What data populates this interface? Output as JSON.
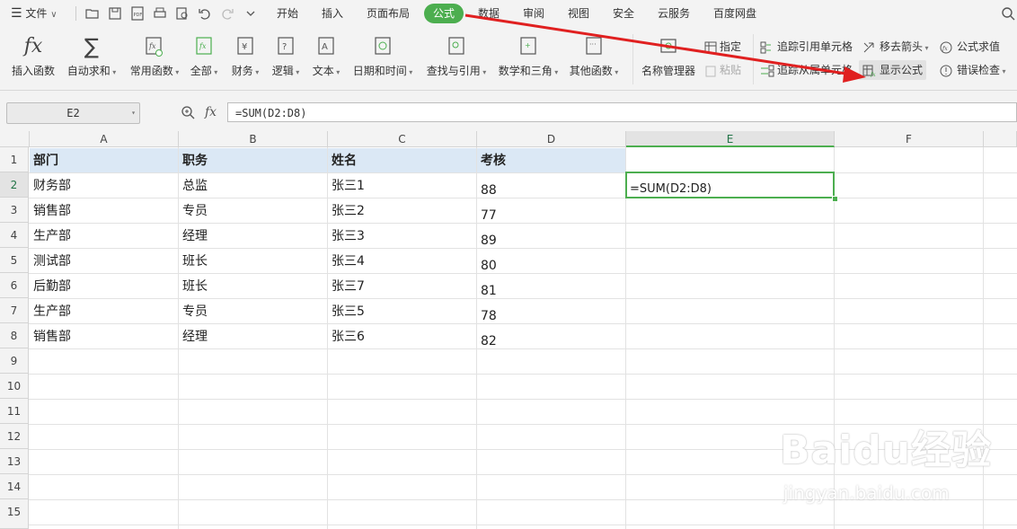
{
  "menu": {
    "file_label": "文件",
    "tabs": [
      "开始",
      "插入",
      "页面布局",
      "公式",
      "数据",
      "审阅",
      "视图",
      "安全",
      "云服务",
      "百度网盘"
    ],
    "active_tab": "公式"
  },
  "ribbon": {
    "insert_function": "插入函数",
    "autosum": "自动求和",
    "common_functions": "常用函数",
    "all": "全部",
    "finance": "财务",
    "logic": "逻辑",
    "text": "文本",
    "datetime": "日期和时间",
    "lookup": "查找与引用",
    "math": "数学和三角",
    "other": "其他函数",
    "name_manager": "名称管理器",
    "define": "指定",
    "paste": "粘贴",
    "trace_precedents": "追踪引用单元格",
    "trace_dependents": "追踪从属单元格",
    "remove_arrows": "移去箭头",
    "show_formulas": "显示公式",
    "evaluate": "公式求值",
    "error_check": "错误检查"
  },
  "formula_bar": {
    "name_box": "E2",
    "fx": "fx",
    "formula": "=SUM(D2:D8)"
  },
  "columns": [
    "A",
    "B",
    "C",
    "D",
    "E",
    "F"
  ],
  "rows": [
    "1",
    "2",
    "3",
    "4",
    "5",
    "6",
    "7",
    "8",
    "9",
    "10",
    "11",
    "12",
    "13",
    "14",
    "15"
  ],
  "sheet": {
    "header": [
      "部门",
      "职务",
      "姓名",
      "考核"
    ],
    "data": [
      [
        "财务部",
        "总监",
        "张三1",
        "88"
      ],
      [
        "销售部",
        "专员",
        "张三2",
        "77"
      ],
      [
        "生产部",
        "经理",
        "张三3",
        "89"
      ],
      [
        "测试部",
        "班长",
        "张三4",
        "80"
      ],
      [
        "后勤部",
        "班长",
        "张三7",
        "81"
      ],
      [
        "生产部",
        "专员",
        "张三5",
        "78"
      ],
      [
        "销售部",
        "经理",
        "张三6",
        "82"
      ]
    ],
    "e2_formula": "=SUM(D2:D8)"
  },
  "watermark": {
    "brand": "Baidu经验",
    "url": "jingyan.baidu.com"
  },
  "colors": {
    "accent_green": "#4cae4f",
    "header_fill": "#dbe8f5",
    "arrow_red": "#e02020"
  }
}
